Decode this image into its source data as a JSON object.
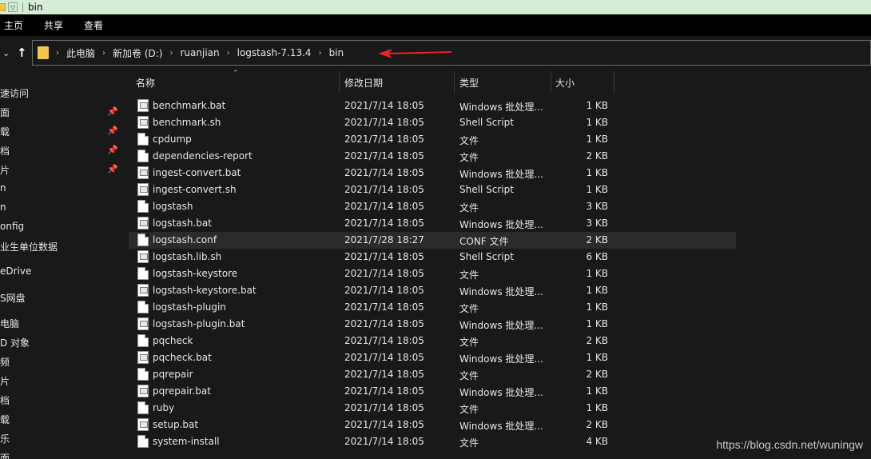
{
  "window": {
    "title": "bin"
  },
  "ribbon": {
    "tabs": [
      "主页",
      "共享",
      "查看"
    ]
  },
  "address": {
    "crumbs": [
      "此电脑",
      "新加卷 (D:)",
      "ruanjian",
      "logstash-7.13.4",
      "bin"
    ]
  },
  "nav": {
    "items": [
      {
        "label": "速访问",
        "pinned": false
      },
      {
        "label": "面",
        "pinned": true
      },
      {
        "label": "载",
        "pinned": true
      },
      {
        "label": "档",
        "pinned": true
      },
      {
        "label": "片",
        "pinned": true
      },
      {
        "label": "n",
        "pinned": false
      },
      {
        "label": "n",
        "pinned": false
      },
      {
        "label": "onfig",
        "pinned": false
      },
      {
        "label": "业生单位数据",
        "pinned": false
      },
      {
        "label": "eDrive",
        "pinned": false
      },
      {
        "label": "S网盘",
        "pinned": false
      },
      {
        "label": "电脑",
        "pinned": false
      },
      {
        "label": "D 对象",
        "pinned": false
      },
      {
        "label": "频",
        "pinned": false
      },
      {
        "label": "片",
        "pinned": false
      },
      {
        "label": "档",
        "pinned": false
      },
      {
        "label": "载",
        "pinned": false
      },
      {
        "label": "乐",
        "pinned": false
      },
      {
        "label": "面",
        "pinned": false
      }
    ]
  },
  "columns": {
    "name": "名称",
    "date": "修改日期",
    "type": "类型",
    "size": "大小"
  },
  "files": [
    {
      "name": "benchmark.bat",
      "date": "2021/7/14 18:05",
      "type": "Windows 批处理...",
      "size": "1 KB",
      "icon": "script"
    },
    {
      "name": "benchmark.sh",
      "date": "2021/7/14 18:05",
      "type": "Shell Script",
      "size": "1 KB",
      "icon": "script"
    },
    {
      "name": "cpdump",
      "date": "2021/7/14 18:05",
      "type": "文件",
      "size": "1 KB",
      "icon": "plain"
    },
    {
      "name": "dependencies-report",
      "date": "2021/7/14 18:05",
      "type": "文件",
      "size": "2 KB",
      "icon": "plain"
    },
    {
      "name": "ingest-convert.bat",
      "date": "2021/7/14 18:05",
      "type": "Windows 批处理...",
      "size": "1 KB",
      "icon": "script"
    },
    {
      "name": "ingest-convert.sh",
      "date": "2021/7/14 18:05",
      "type": "Shell Script",
      "size": "1 KB",
      "icon": "script"
    },
    {
      "name": "logstash",
      "date": "2021/7/14 18:05",
      "type": "文件",
      "size": "3 KB",
      "icon": "plain"
    },
    {
      "name": "logstash.bat",
      "date": "2021/7/14 18:05",
      "type": "Windows 批处理...",
      "size": "3 KB",
      "icon": "script"
    },
    {
      "name": "logstash.conf",
      "date": "2021/7/28 18:27",
      "type": "CONF 文件",
      "size": "2 KB",
      "icon": "plain",
      "selected": true
    },
    {
      "name": "logstash.lib.sh",
      "date": "2021/7/14 18:05",
      "type": "Shell Script",
      "size": "6 KB",
      "icon": "script"
    },
    {
      "name": "logstash-keystore",
      "date": "2021/7/14 18:05",
      "type": "文件",
      "size": "1 KB",
      "icon": "plain"
    },
    {
      "name": "logstash-keystore.bat",
      "date": "2021/7/14 18:05",
      "type": "Windows 批处理...",
      "size": "1 KB",
      "icon": "script"
    },
    {
      "name": "logstash-plugin",
      "date": "2021/7/14 18:05",
      "type": "文件",
      "size": "1 KB",
      "icon": "plain"
    },
    {
      "name": "logstash-plugin.bat",
      "date": "2021/7/14 18:05",
      "type": "Windows 批处理...",
      "size": "1 KB",
      "icon": "script"
    },
    {
      "name": "pqcheck",
      "date": "2021/7/14 18:05",
      "type": "文件",
      "size": "2 KB",
      "icon": "plain"
    },
    {
      "name": "pqcheck.bat",
      "date": "2021/7/14 18:05",
      "type": "Windows 批处理...",
      "size": "1 KB",
      "icon": "script"
    },
    {
      "name": "pqrepair",
      "date": "2021/7/14 18:05",
      "type": "文件",
      "size": "2 KB",
      "icon": "plain"
    },
    {
      "name": "pqrepair.bat",
      "date": "2021/7/14 18:05",
      "type": "Windows 批处理...",
      "size": "1 KB",
      "icon": "script"
    },
    {
      "name": "ruby",
      "date": "2021/7/14 18:05",
      "type": "文件",
      "size": "1 KB",
      "icon": "plain"
    },
    {
      "name": "setup.bat",
      "date": "2021/7/14 18:05",
      "type": "Windows 批处理...",
      "size": "2 KB",
      "icon": "script"
    },
    {
      "name": "system-install",
      "date": "2021/7/14 18:05",
      "type": "文件",
      "size": "4 KB",
      "icon": "plain"
    }
  ],
  "watermark": "https://blog.csdn.net/wuningw"
}
